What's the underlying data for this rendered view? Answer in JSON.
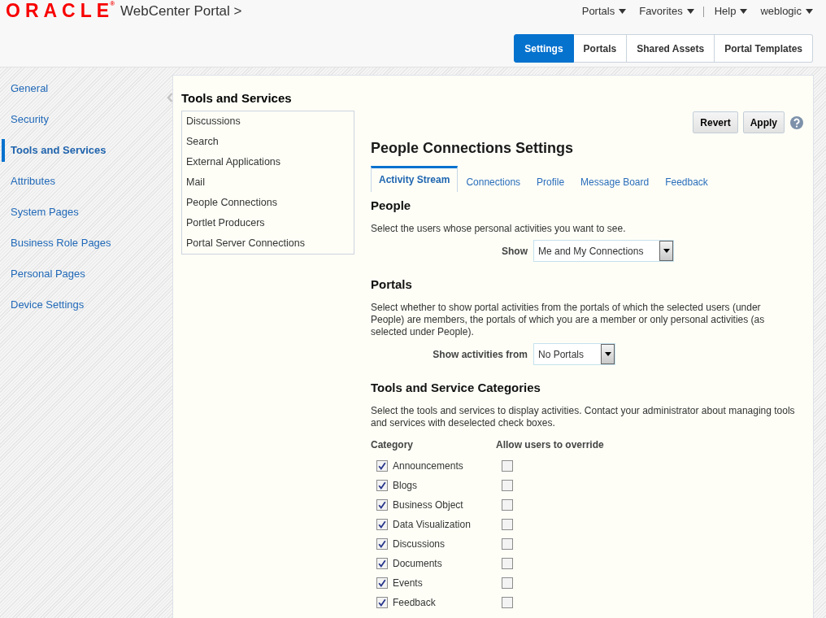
{
  "header": {
    "logo": "ORACLE",
    "logo_mark": "®",
    "product": "WebCenter Portal >",
    "nav_menus": [
      {
        "label": "Portals"
      },
      {
        "label": "Favorites"
      }
    ],
    "user_menus": [
      {
        "label": "Help"
      },
      {
        "label": "weblogic"
      }
    ],
    "tabs": [
      {
        "label": "Settings",
        "selected": true
      },
      {
        "label": "Portals",
        "selected": false
      },
      {
        "label": "Shared Assets",
        "selected": false
      },
      {
        "label": "Portal Templates",
        "selected": false
      }
    ]
  },
  "sidebar": {
    "items": [
      {
        "label": "General",
        "selected": false
      },
      {
        "label": "Security",
        "selected": false
      },
      {
        "label": "Tools and Services",
        "selected": true
      },
      {
        "label": "Attributes",
        "selected": false
      },
      {
        "label": "System Pages",
        "selected": false
      },
      {
        "label": "Business Role Pages",
        "selected": false
      },
      {
        "label": "Personal Pages",
        "selected": false
      },
      {
        "label": "Device Settings",
        "selected": false
      }
    ]
  },
  "services": {
    "title": "Tools and Services",
    "items": [
      {
        "label": "Discussions",
        "selected": false
      },
      {
        "label": "Search",
        "selected": false
      },
      {
        "label": "External Applications",
        "selected": false
      },
      {
        "label": "Mail",
        "selected": false
      },
      {
        "label": "People Connections",
        "selected": false
      },
      {
        "label": "Portlet Producers",
        "selected": false
      },
      {
        "label": "Portal Server Connections",
        "selected": false
      }
    ]
  },
  "settings": {
    "title": "People Connections Settings",
    "buttons": [
      {
        "label": "Revert"
      },
      {
        "label": "Apply"
      }
    ],
    "tabs": [
      {
        "label": "Activity Stream",
        "selected": true
      },
      {
        "label": "Connections",
        "selected": false
      },
      {
        "label": "Profile",
        "selected": false
      },
      {
        "label": "Message Board",
        "selected": false
      },
      {
        "label": "Feedback",
        "selected": false
      }
    ],
    "people": {
      "heading": "People",
      "description": "Select the users whose personal activities you want to see.",
      "field": {
        "label": "Show",
        "value": "Me and My Connections"
      }
    },
    "portals": {
      "heading": "Portals",
      "description": "Select whether to show portal activities from the portals of which the selected users (under People) are members, the portals of which you are a member or only personal activities (as selected under People).",
      "field": {
        "label": "Show activities from",
        "value": "No Portals"
      }
    },
    "categories": {
      "heading": "Tools and Service Categories",
      "description": "Select the tools and services to display activities. Contact your administrator about managing tools and services with deselected check boxes.",
      "columns": [
        "Category",
        "Allow users to override"
      ],
      "rows": [
        {
          "label": "Announcements",
          "checked": true,
          "allow_override": false
        },
        {
          "label": "Blogs",
          "checked": true,
          "allow_override": false
        },
        {
          "label": "Business Object",
          "checked": true,
          "allow_override": false
        },
        {
          "label": "Data Visualization",
          "checked": true,
          "allow_override": false
        },
        {
          "label": "Discussions",
          "checked": true,
          "allow_override": false
        },
        {
          "label": "Documents",
          "checked": true,
          "allow_override": false
        },
        {
          "label": "Events",
          "checked": true,
          "allow_override": false
        },
        {
          "label": "Feedback",
          "checked": true,
          "allow_override": false
        }
      ]
    }
  }
}
